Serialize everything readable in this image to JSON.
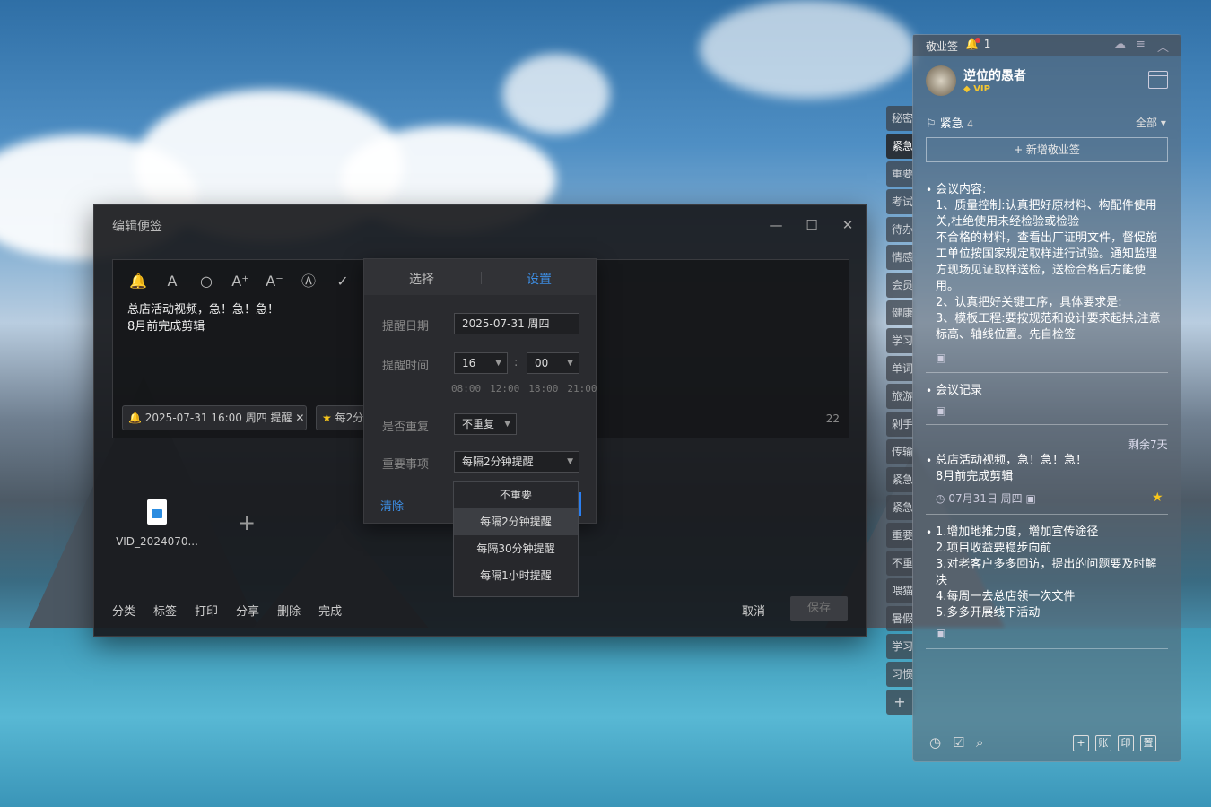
{
  "edit_window": {
    "title": "编辑便签",
    "minimize": "—",
    "maximize": "☐",
    "close": "✕",
    "toolbar": [
      "🔔",
      "A",
      "○",
      "A⁺",
      "A⁻",
      "Ⓐ",
      "✓"
    ],
    "note_lines": [
      "总店活动视频，急！急！急！",
      "8月前完成剪辑"
    ],
    "reminder_chip": "2025-07-31 16:00 周四 提醒",
    "importance_chip": "每2分",
    "char_count": "22",
    "attachment_name": "VID_2024070...",
    "add_attachment": "+",
    "bottom_actions": [
      "分类",
      "标签",
      "打印",
      "分享",
      "删除",
      "完成"
    ],
    "cancel_label": "取消",
    "save_label": "保存"
  },
  "reminder_popup": {
    "tab_select": "选择",
    "tab_settings": "设置",
    "date_label": "提醒日期",
    "date_value": "2025-07-31  周四",
    "time_label": "提醒时间",
    "hour_value": "16",
    "minute_value": "00",
    "time_sep": ":",
    "quick_times": [
      "08:00",
      "12:00",
      "18:00",
      "21:00"
    ],
    "repeat_label": "是否重复",
    "repeat_value": "不重复",
    "importance_label": "重要事项",
    "importance_value": "每隔2分钟提醒",
    "clear_label": "清除",
    "importance_options": [
      "不重要",
      "每隔2分钟提醒",
      "每隔30分钟提醒",
      "每隔1小时提醒"
    ]
  },
  "side_tabs": [
    "秘密",
    "紧急",
    "重要",
    "考试",
    "待办",
    "情感",
    "会员",
    "健康",
    "学习",
    "单词",
    "旅游",
    "剁手",
    "传输",
    "紧急",
    "紧急",
    "重要",
    "不重",
    "喂猫",
    "暑假",
    "学习",
    "习惯",
    "+"
  ],
  "notes_panel": {
    "app_name": "敬业签",
    "notification_count": "1",
    "username": "逆位的愚者",
    "vip_label": "VIP",
    "category_name": "紧急",
    "category_count": "4",
    "filter_label": "全部 ▾",
    "add_note_label": "+ 新增敬业签",
    "notes": [
      {
        "lines": [
          "会议内容:",
          "1、质量控制:认真把好原材料、构配件使用",
          "关,杜绝使用未经检验或检验",
          "不合格的材料，查看出厂证明文件，督促施",
          "工单位按国家规定取样进行试验。通知监理",
          "方现场见证取样送检，送检合格后方能使",
          "用。",
          "2、认真把好关键工序，具体要求是:",
          "3、模板工程:要按规范和设计要求起拱,注意",
          "标高、轴线位置。先自检签"
        ]
      },
      {
        "lines": [
          "会议记录"
        ]
      },
      {
        "remaining": "剩余7天",
        "lines": [
          "总店活动视频，急！急！急！",
          "8月前完成剪辑"
        ],
        "meta": "07月31日 周四"
      },
      {
        "lines": [
          "1.增加地推力度，增加宣传途径",
          "2.项目收益要稳步向前",
          "3.对老客户多多回访，提出的问题要及时解",
          "决",
          "4.每周一去总店领一次文件",
          "5.多多开展线下活动"
        ]
      }
    ],
    "footer_boxes": [
      "+",
      "账",
      "印",
      "置"
    ]
  }
}
